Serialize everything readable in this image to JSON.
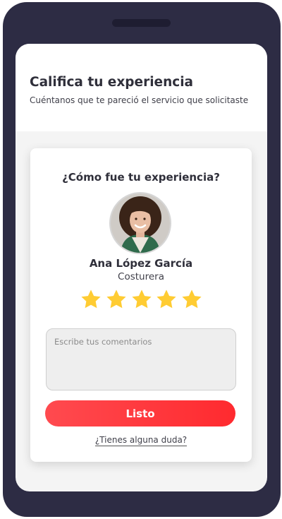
{
  "header": {
    "title": "Califica tu experiencia",
    "subtitle": "Cuéntanos que te pareció el servicio que solicitaste"
  },
  "card": {
    "question": "¿Cómo fue tu experiencia?",
    "provider": {
      "name": "Ana López García",
      "role": "Costurera"
    },
    "rating": {
      "value": 5,
      "max": 5
    },
    "comment": {
      "placeholder": "Escribe tus comentarios",
      "value": ""
    },
    "submit_label": "Listo",
    "help_link": "¿Tienes alguna duda?"
  },
  "colors": {
    "phone_frame": "#2d2c44",
    "accent_red": "#ff3a3f",
    "star_yellow": "#ffcc33"
  }
}
